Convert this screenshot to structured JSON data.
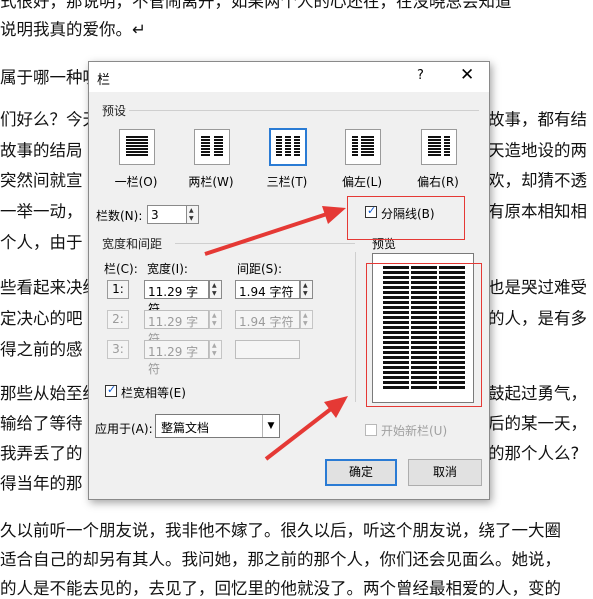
{
  "document": {
    "lines": [
      "式很好，那说明，不管闹离开，如果两个人的心还在，在没晓总会知道",
      "说明我真的爱你。↵",
      "属于哪一种呢",
      "们好么？今天",
      "故事的结局",
      "突然间就宣",
      "一举一动，",
      "个人，由于",
      "些看起来决绝",
      "定决心的吧",
      "得之前的感",
      "那些从始至终",
      "输给了等待",
      "我弄丢了的",
      "得当年的那",
      "久以前听一个朋友说，我非他不嫁了。很久以后，听这个朋友说，绕了一大圈",
      "适合自己的却另有其人。我问她，那之前的那个人，你们还会见面么。她说，",
      "的人是不能去见的，去见了，回忆里的他就没了。两个曾经最相爱的人，变的"
    ],
    "right_fragments": [
      "故事，都有结",
      "天造地设的两",
      "欢，却猜不透",
      "有原本相知相",
      "也是哭过难受",
      "的人，是有多",
      "鼓起过勇气，",
      "后的某一天，",
      "的那个人么?"
    ]
  },
  "dialog": {
    "title": "栏",
    "help": "?",
    "close": "✕",
    "presets": {
      "group_label": "预设",
      "items": [
        {
          "label": "一栏(O)",
          "columns": 1
        },
        {
          "label": "两栏(W)",
          "columns": 2
        },
        {
          "label": "三栏(T)",
          "columns": 3
        },
        {
          "label": "偏左(L)",
          "columns": "left"
        },
        {
          "label": "偏右(R)",
          "columns": "right"
        }
      ],
      "selected": 2
    },
    "num_columns": {
      "label": "栏数(N):",
      "value": "3"
    },
    "separator": {
      "label": "分隔线(B)",
      "checked": true
    },
    "width_spacing": {
      "group_label": "宽度和间距",
      "headers": {
        "col": "栏(C):",
        "width": "宽度(I):",
        "spacing": "间距(S):"
      },
      "rows": [
        {
          "col": "1:",
          "width": "11.29 字符",
          "spacing": "1.94 字符",
          "enabled": true
        },
        {
          "col": "2:",
          "width": "11.29 字符",
          "spacing": "1.94 字符",
          "enabled": false
        },
        {
          "col": "3:",
          "width": "11.29 字符",
          "spacing": "",
          "enabled": false
        }
      ]
    },
    "equal_width": {
      "label": "栏宽相等(E)",
      "checked": true
    },
    "preview": {
      "label": "预览",
      "columns": 3
    },
    "apply_to": {
      "label": "应用于(A):",
      "value": "整篇文档"
    },
    "new_column": {
      "label": "开始新栏(U)",
      "checked": false,
      "enabled": false
    },
    "ok_label": "确定",
    "cancel_label": "取消"
  },
  "colors": {
    "accent": "#2a7bd4",
    "annotation_red": "#e53935"
  }
}
